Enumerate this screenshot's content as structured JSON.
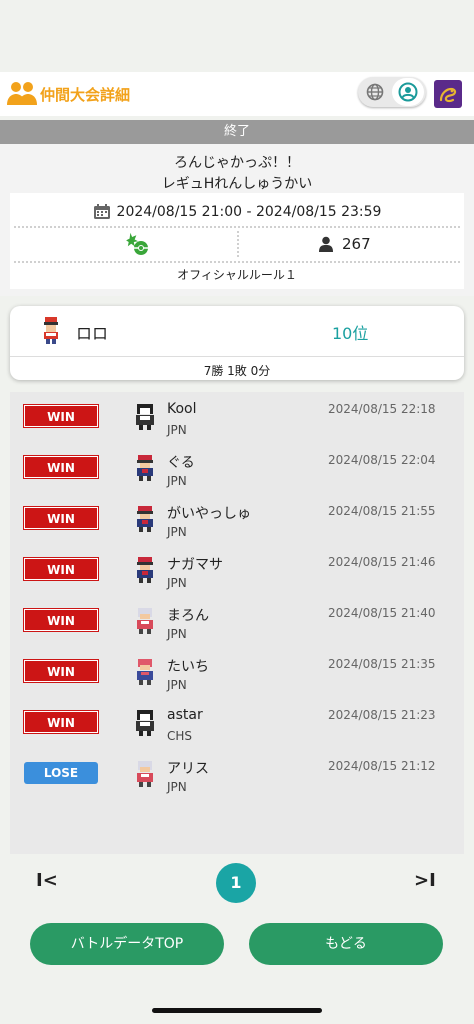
{
  "header": {
    "title": "仲間大会詳細",
    "accent_color": "#f2a21b"
  },
  "status": {
    "ended_label": "終了"
  },
  "tournament": {
    "name_line1": "ろんじゃかっぷ！！",
    "name_line2": "レギュHれんしゅうかい",
    "date_range": "2024/08/15 21:00 - 2024/08/15 23:59",
    "players_count": "267",
    "rule": "オフィシャルルール１"
  },
  "player": {
    "name": "ロロ",
    "rank": "10位",
    "record": "7勝 1敗 0分"
  },
  "matches": [
    {
      "result": "WIN",
      "name": "Kool",
      "country": "JPN",
      "time": "2024/08/15 22:18"
    },
    {
      "result": "WIN",
      "name": "ぐる",
      "country": "JPN",
      "time": "2024/08/15 22:04"
    },
    {
      "result": "WIN",
      "name": "がいやっしゅ",
      "country": "JPN",
      "time": "2024/08/15 21:55"
    },
    {
      "result": "WIN",
      "name": "ナガマサ",
      "country": "JPN",
      "time": "2024/08/15 21:46"
    },
    {
      "result": "WIN",
      "name": "まろん",
      "country": "JPN",
      "time": "2024/08/15 21:40"
    },
    {
      "result": "WIN",
      "name": "たいち",
      "country": "JPN",
      "time": "2024/08/15 21:35"
    },
    {
      "result": "WIN",
      "name": "astar",
      "country": "CHS",
      "time": "2024/08/15 21:23"
    },
    {
      "result": "LOSE",
      "name": "アリス",
      "country": "JPN",
      "time": "2024/08/15 21:12"
    }
  ],
  "pagination": {
    "first": "I<",
    "current": "1",
    "last": ">I"
  },
  "buttons": {
    "battle_top": "バトルデータTOP",
    "back": "もどる"
  },
  "colors": {
    "win": "#cc1515",
    "lose": "#3b8fdc",
    "rank": "#1aa0a0",
    "button": "#2a9a64"
  },
  "icons": {
    "header": "people-icon",
    "toggle_left": "globe-icon",
    "toggle_right": "user-circle-icon",
    "app": "dragon-app-icon",
    "date": "calendar-icon",
    "tournament_type": "point-icon",
    "players": "person-icon"
  }
}
